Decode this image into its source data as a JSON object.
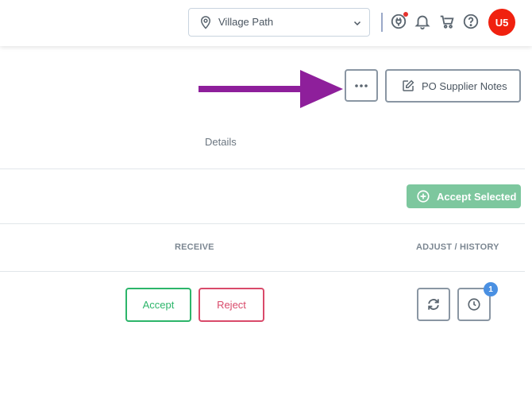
{
  "header": {
    "location": "Village Path",
    "avatar_initials": "U5",
    "avatar_color": "#f0210f"
  },
  "toolbar": {
    "more_label": "•••",
    "notes_label": "PO Supplier Notes"
  },
  "section": {
    "details_label": "Details",
    "accept_selected_label": "Accept Selected"
  },
  "columns": {
    "receive": "RECEIVE",
    "adjust_history": "ADJUST / HISTORY"
  },
  "row": {
    "accept_label": "Accept",
    "reject_label": "Reject",
    "history_badge": "1"
  },
  "colors": {
    "accept": "#2cb56a",
    "reject": "#d94a6a",
    "accept_selected_bg": "#7dc79e",
    "annotation_arrow": "#8e1f9b",
    "badge": "#4a90e2"
  }
}
